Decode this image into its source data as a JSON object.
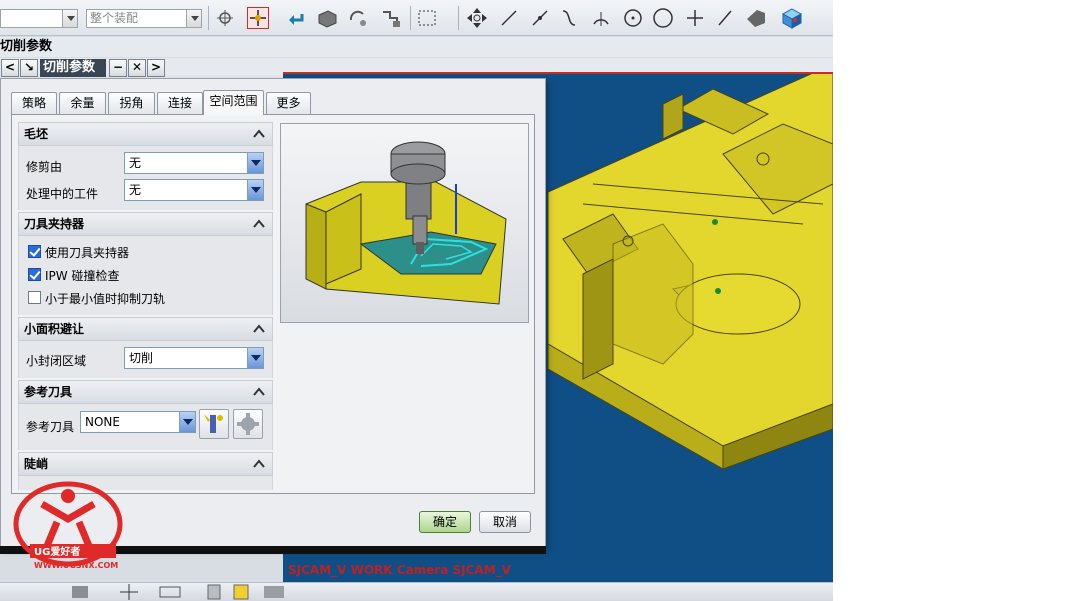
{
  "toolbar": {
    "filter_combo": "",
    "scope_combo": "整个装配",
    "icons": [
      "snap-point-icon",
      "undo-arrow-icon",
      "box-view-icon",
      "rotate-icon",
      "transform-icon",
      "select-box-icon",
      "move-arrows-icon",
      "line-icon",
      "line-dash-icon",
      "curve-icon",
      "arc-icon",
      "circle-point-icon",
      "circle-icon",
      "plus-icon",
      "slash-icon",
      "shape-icon",
      "cube-icon"
    ]
  },
  "title_row": {
    "label": "切削参数"
  },
  "nav": {
    "title": "切削参数",
    "back": "<",
    "arrow": "↘",
    "minimize": "−",
    "close": "✕",
    "forward": ">"
  },
  "tabs": [
    {
      "label": "策略",
      "active": false
    },
    {
      "label": "余量",
      "active": false
    },
    {
      "label": "拐角",
      "active": false
    },
    {
      "label": "连接",
      "active": false
    },
    {
      "label": "空间范围",
      "active": true
    },
    {
      "label": "更多",
      "active": false
    }
  ],
  "groups": {
    "blank": {
      "title": "毛坯",
      "trim_by_label": "修剪由",
      "trim_by_value": "无",
      "ipw_label": "处理中的工件",
      "ipw_value": "无"
    },
    "holder": {
      "title": "刀具夹持器",
      "use_holder_label": "使用刀具夹持器",
      "use_holder_checked": true,
      "ipw_check_label": "IPW 碰撞检查",
      "ipw_check_checked": true,
      "suppress_label": "小于最小值时抑制刀轨",
      "suppress_checked": false
    },
    "small_area": {
      "title": "小面积避让",
      "closed_area_label": "小封闭区域",
      "closed_area_value": "切削"
    },
    "ref_tool": {
      "title": "参考刀具",
      "ref_tool_label": "参考刀具",
      "ref_tool_value": "NONE"
    },
    "steep": {
      "title": "陡峭"
    }
  },
  "buttons": {
    "ok": "确定",
    "cancel": "取消"
  },
  "viewport": {
    "label": "SJCAM_V WORK Camera SJCAM_V"
  },
  "logo": {
    "text": "UG爱好者",
    "url_text": "WWW.UGSNX.COM"
  },
  "colors": {
    "part_yellow": "#e3d62c",
    "viewport_blue": "#0f4f86",
    "ok_green": "#aed58e"
  }
}
